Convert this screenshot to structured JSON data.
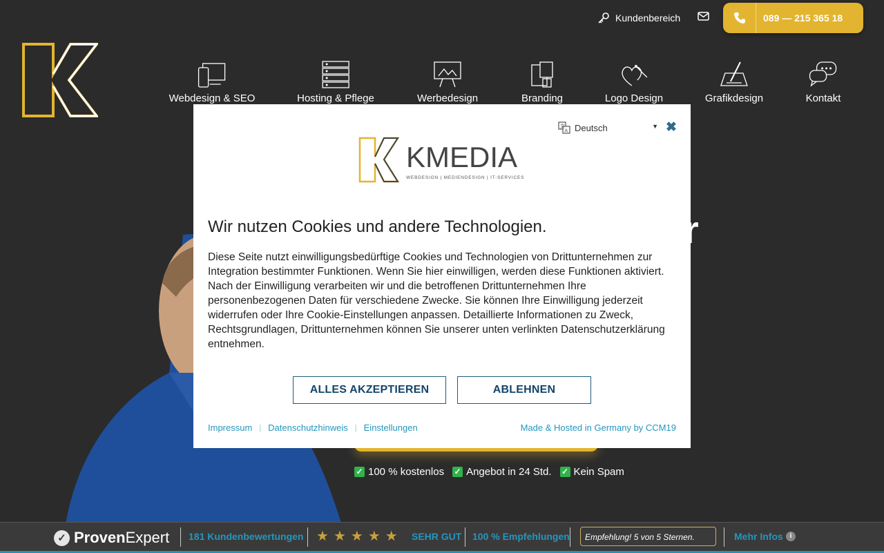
{
  "header": {
    "kundenbereich_label": "Kundenbereich",
    "phone_number": "089 — 215 365 18",
    "icons": {
      "key": "key-icon",
      "mail": "mail-icon",
      "phone": "phone-icon"
    }
  },
  "nav": {
    "items": [
      {
        "label": "Webdesign & SEO",
        "icon": "devices-icon"
      },
      {
        "label": "Hosting & Pflege",
        "icon": "server-icon"
      },
      {
        "label": "Werbedesign",
        "icon": "billboard-icon"
      },
      {
        "label": "Branding",
        "icon": "brand-icon"
      },
      {
        "label": "Logo Design",
        "icon": "heart-pen-icon"
      },
      {
        "label": "Grafikdesign",
        "icon": "tablet-pen-icon"
      },
      {
        "label": "Kontakt",
        "icon": "chat-icon"
      }
    ]
  },
  "hero": {
    "checks": [
      "100 % kostenlos",
      "Angebot in 24 Std.",
      "Kein Spam"
    ]
  },
  "cookie_modal": {
    "language": "Deutsch",
    "close_label": "✖",
    "logo_text": "KMEDIA",
    "logo_tagline": "WEBDESIGN | MEDIENDESIGN | IT-SERVICES",
    "title": "Wir nutzen Cookies und andere Technologien.",
    "body": "Diese Seite nutzt einwilligungsbedürftige Cookies und Technologien von Drittunternehmen zur Integration bestimmter Funktionen. Wenn Sie hier einwilligen, werden diese Funktionen aktiviert. Nach der Einwilligung verarbeiten wir und die betroffenen Drittunternehmen Ihre personenbezogenen Daten für verschiedene Zwecke. Sie können Ihre Einwilligung jederzeit widerrufen oder Ihre Cookie-Einstellungen anpassen. Detaillierte Informationen zu Zweck, Rechtsgrundlagen, Drittunternehmen können Sie unserer unten verlinkten Datenschutzerklärung entnehmen.",
    "accept_label": "ALLES AKZEPTIEREN",
    "reject_label": "ABLEHNEN",
    "links": [
      "Impressum",
      "Datenschutzhinweis",
      "Einstellungen"
    ],
    "made_in": "Made & Hosted in Germany by CCM19"
  },
  "proven_expert": {
    "brand_bold": "Proven",
    "brand_light": "Expert",
    "reviews": "181 Kundenbewertungen",
    "rating_stars": 5,
    "rating_label": "SEHR GUT",
    "recommendations": "100 % Empfehlungen",
    "bubble": "Empfehlung! 5 von 5 Sternen.",
    "more_info": "Mehr Infos",
    "info_icon": "i"
  },
  "colors": {
    "background": "#2b2b2b",
    "accent_gold": "#e3b42f",
    "link_blue": "#2596be",
    "button_text": "#12456a"
  }
}
